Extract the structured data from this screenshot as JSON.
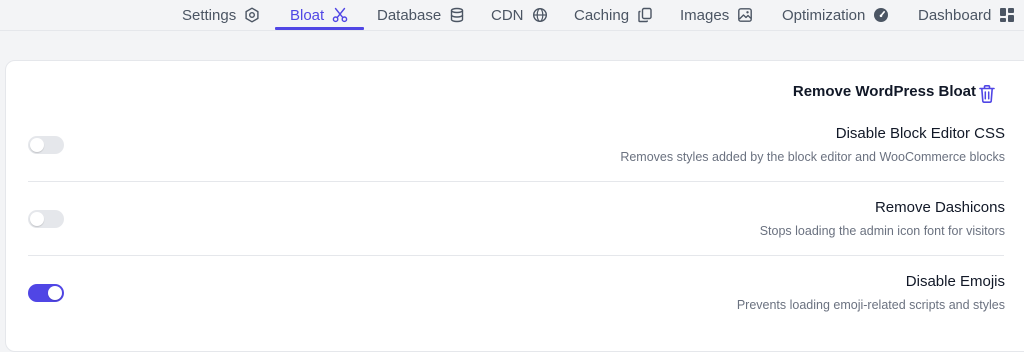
{
  "nav": {
    "tabs": [
      {
        "label": "Settings",
        "icon": "settings-hex-icon"
      },
      {
        "label": "Bloat",
        "icon": "scissors-icon",
        "active": true
      },
      {
        "label": "Database",
        "icon": "database-icon"
      },
      {
        "label": "CDN",
        "icon": "globe-icon"
      },
      {
        "label": "Caching",
        "icon": "copy-icon"
      },
      {
        "label": "Images",
        "icon": "image-icon"
      },
      {
        "label": "Optimization",
        "icon": "gauge-icon"
      },
      {
        "label": "Dashboard",
        "icon": "dashboard-grid-icon"
      }
    ]
  },
  "section": {
    "title": "Remove WordPress Bloat",
    "icon": "trash-icon"
  },
  "options": [
    {
      "title": "Disable Block Editor CSS",
      "description": "Removes styles added by the block editor and WooCommerce blocks",
      "enabled": false
    },
    {
      "title": "Remove Dashicons",
      "description": "Stops loading the admin icon font for visitors",
      "enabled": false
    },
    {
      "title": "Disable Emojis",
      "description": "Prevents loading emoji-related scripts and styles",
      "enabled": true
    }
  ],
  "colors": {
    "accent": "#5046e5",
    "toggle_off": "#e5e7eb"
  }
}
